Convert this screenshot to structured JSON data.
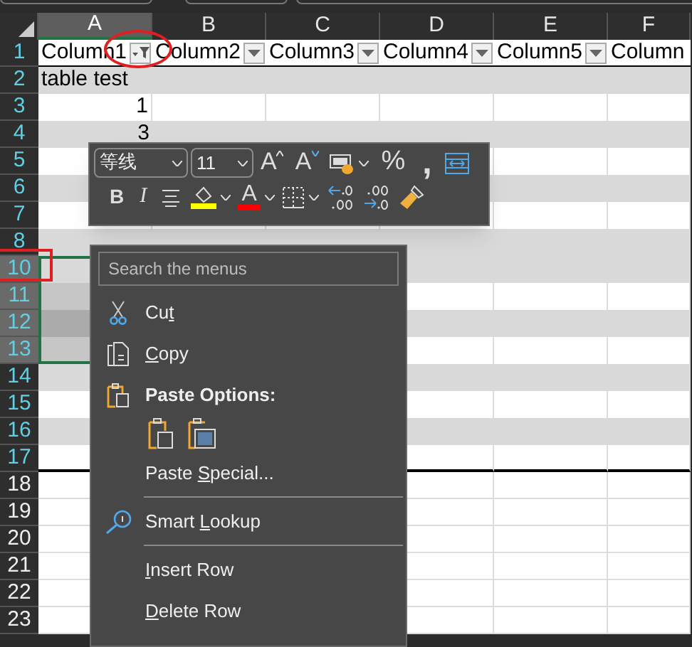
{
  "columns": [
    {
      "letter": "A",
      "selected": true
    },
    {
      "letter": "B",
      "selected": false
    },
    {
      "letter": "C",
      "selected": false
    },
    {
      "letter": "D",
      "selected": false
    },
    {
      "letter": "E",
      "selected": false
    },
    {
      "letter": "F",
      "selected": false
    }
  ],
  "header_row_number": "1",
  "table_header": [
    {
      "label": "Column1",
      "filtered": true
    },
    {
      "label": "Column2",
      "filtered": false
    },
    {
      "label": "Column3",
      "filtered": false
    },
    {
      "label": "Column4",
      "filtered": false
    },
    {
      "label": "Column5",
      "filtered": false
    },
    {
      "label": "Column"
    }
  ],
  "rows": [
    {
      "number": "2",
      "in_table": true,
      "banded": true,
      "selected": false,
      "value": "table test"
    },
    {
      "number": "3",
      "in_table": true,
      "banded": false,
      "selected": false,
      "value": "1"
    },
    {
      "number": "4",
      "in_table": true,
      "banded": true,
      "selected": false,
      "value": "3"
    },
    {
      "number": "5",
      "in_table": true,
      "banded": false,
      "selected": false
    },
    {
      "number": "6",
      "in_table": true,
      "banded": true,
      "selected": false
    },
    {
      "number": "7",
      "in_table": true,
      "banded": false,
      "selected": false
    },
    {
      "number": "8",
      "in_table": true,
      "banded": true,
      "selected": false
    },
    {
      "number": "10",
      "in_table": true,
      "banded": true,
      "selected": true
    },
    {
      "number": "11",
      "in_table": true,
      "banded": false,
      "selected": true
    },
    {
      "number": "12",
      "in_table": true,
      "banded": true,
      "selected": true
    },
    {
      "number": "13",
      "in_table": true,
      "banded": false,
      "selected": true
    },
    {
      "number": "14",
      "in_table": true,
      "banded": true,
      "selected": false
    },
    {
      "number": "15",
      "in_table": true,
      "banded": false,
      "selected": false
    },
    {
      "number": "16",
      "in_table": true,
      "banded": true,
      "selected": false
    },
    {
      "number": "17",
      "in_table": true,
      "banded": false,
      "selected": false
    },
    {
      "number": "18",
      "in_table": false,
      "banded": false,
      "selected": false
    },
    {
      "number": "19",
      "in_table": false,
      "banded": false,
      "selected": false
    },
    {
      "number": "20",
      "in_table": false,
      "banded": false,
      "selected": false
    },
    {
      "number": "21",
      "in_table": false,
      "banded": false,
      "selected": false
    },
    {
      "number": "22",
      "in_table": false,
      "banded": false,
      "selected": false
    },
    {
      "number": "23",
      "in_table": false,
      "banded": false,
      "selected": false
    }
  ],
  "mini_toolbar": {
    "font": "等线",
    "size": "11",
    "row_1": [
      {
        "kind": "grow_font",
        "glyph": "A"
      },
      {
        "kind": "shrink_font",
        "glyph": "A"
      },
      {
        "kind": "cell_styles"
      },
      {
        "kind": "percent",
        "glyph": "%"
      },
      {
        "kind": "comma",
        "glyph": ","
      },
      {
        "kind": "wrap"
      }
    ],
    "row_2": [
      {
        "kind": "bold",
        "glyph": "B"
      },
      {
        "kind": "italic",
        "glyph": "I"
      },
      {
        "kind": "center"
      },
      {
        "kind": "fill_color",
        "color": "#ffff00"
      },
      {
        "kind": "font_color",
        "glyph": "A",
        "color": "#ff0000"
      },
      {
        "kind": "borders"
      },
      {
        "kind": "decrease_decimal"
      },
      {
        "kind": "increase_decimal"
      },
      {
        "kind": "format_painter"
      }
    ]
  },
  "context_menu": {
    "search_placeholder": "Search the menus",
    "items": [
      {
        "kind": "item",
        "label": "Cut"
      },
      {
        "kind": "item",
        "label": "Copy"
      },
      {
        "kind": "heading",
        "label": "Paste Options:"
      },
      {
        "kind": "paste_buttons"
      },
      {
        "kind": "item",
        "label": "Paste Special..."
      },
      {
        "kind": "separator"
      },
      {
        "kind": "item",
        "label": "Smart Lookup"
      },
      {
        "kind": "separator"
      },
      {
        "kind": "item",
        "label": "Insert Row"
      },
      {
        "kind": "item",
        "label": "Delete Row"
      }
    ]
  }
}
